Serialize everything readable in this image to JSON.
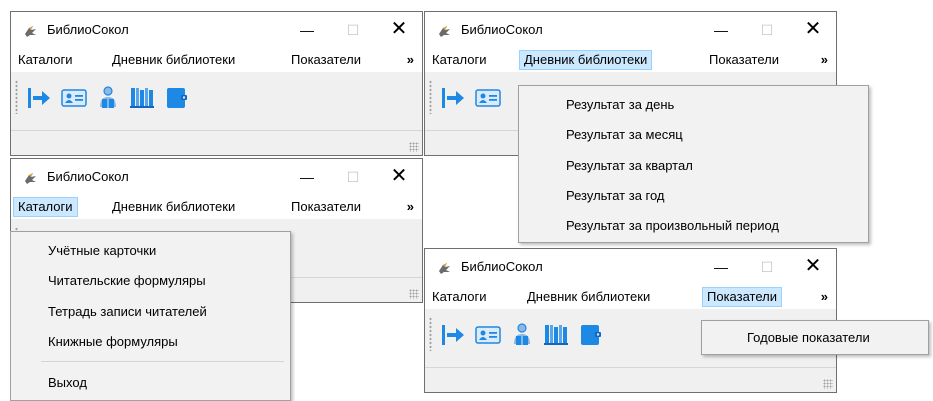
{
  "app": {
    "title": "БиблиоСокол"
  },
  "window_controls": {
    "minimize": "—",
    "maximize": "☐",
    "close": "✕"
  },
  "menu": {
    "catalogs": "Каталоги",
    "diary": "Дневник библиотеки",
    "indicators": "Показатели",
    "overflow": "»"
  },
  "toolbar_icons": [
    "arrow-right-icon",
    "id-card-icon",
    "reader-icon",
    "bookshelf-icon",
    "notebook-icon"
  ],
  "catalogs_menu": {
    "items": [
      "Учётные карточки",
      "Читательские формуляры",
      "Тетрадь записи читателей",
      "Книжные формуляры"
    ],
    "exit": "Выход"
  },
  "diary_menu": {
    "items": [
      "Результат за день",
      "Результат за месяц",
      "Результат за квартал",
      "Результат за год",
      "Результат за произвольный период"
    ]
  },
  "indicators_menu": {
    "items": [
      "Годовые показатели"
    ]
  },
  "colors": {
    "menu_highlight": "#cce8ff",
    "menu_highlight_border": "#99d1ff",
    "icon_blue": "#1e88e5"
  }
}
